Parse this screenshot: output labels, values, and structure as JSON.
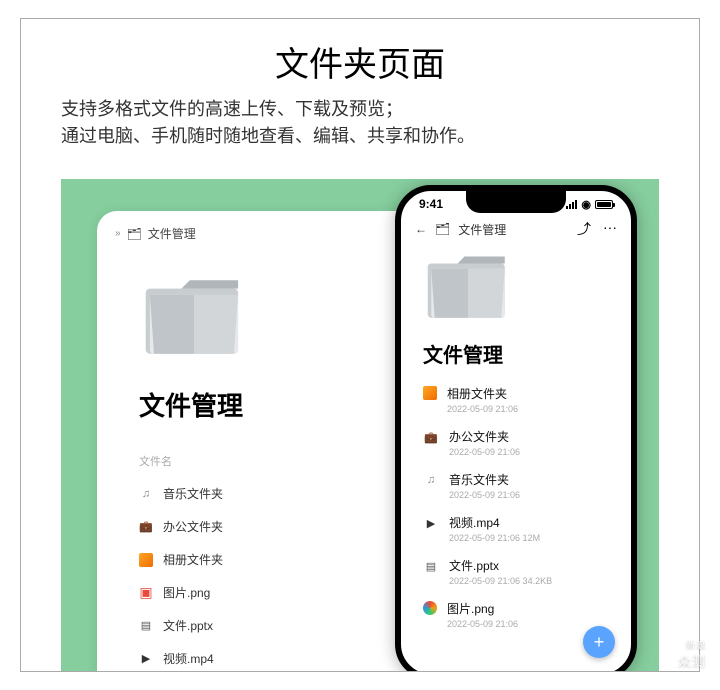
{
  "page": {
    "title": "文件夹页面",
    "desc_line1": "支持多格式文件的高速上传、下载及预览；",
    "desc_line2": "通过电脑、手机随时随地查看、编辑、共享和协作。"
  },
  "tablet": {
    "crumb_chev": "»",
    "crumb_title": "文件管理",
    "heading": "文件管理",
    "list_header": "文件名",
    "items": [
      {
        "icon": "music",
        "glyph": "♫",
        "name": "音乐文件夹"
      },
      {
        "icon": "briefcase",
        "glyph": "💼",
        "name": "办公文件夹"
      },
      {
        "icon": "album",
        "glyph": "",
        "name": "相册文件夹"
      },
      {
        "icon": "img",
        "glyph": "▣",
        "name": "图片.png"
      },
      {
        "icon": "doc",
        "glyph": "▤",
        "name": "文件.pptx"
      },
      {
        "icon": "vid",
        "glyph": "▶",
        "name": "视频.mp4"
      }
    ]
  },
  "phone": {
    "time": "9:41",
    "crumb_back": "←",
    "crumb_title": "文件管理",
    "share_icon": "⤴",
    "more_icon": "···",
    "heading": "文件管理",
    "items": [
      {
        "icon": "album",
        "glyph": "",
        "name": "相册文件夹",
        "meta": "2022-05-09 21:06"
      },
      {
        "icon": "briefcase",
        "glyph": "💼",
        "name": "办公文件夹",
        "meta": "2022-05-09 21:06"
      },
      {
        "icon": "music",
        "glyph": "♫",
        "name": "音乐文件夹",
        "meta": "2022-05-09 21:06"
      },
      {
        "icon": "vid",
        "glyph": "▶",
        "name": "视频.mp4",
        "meta": "2022-05-09 21:06   12M"
      },
      {
        "icon": "doc",
        "glyph": "▤",
        "name": "文件.pptx",
        "meta": "2022-05-09 21:06   34.2KB"
      },
      {
        "icon": "pic",
        "glyph": "",
        "name": "图片.png",
        "meta": "2022-05-09 21:06"
      }
    ],
    "fab": "+"
  },
  "watermark": {
    "top": "新浪",
    "main": "众测"
  }
}
